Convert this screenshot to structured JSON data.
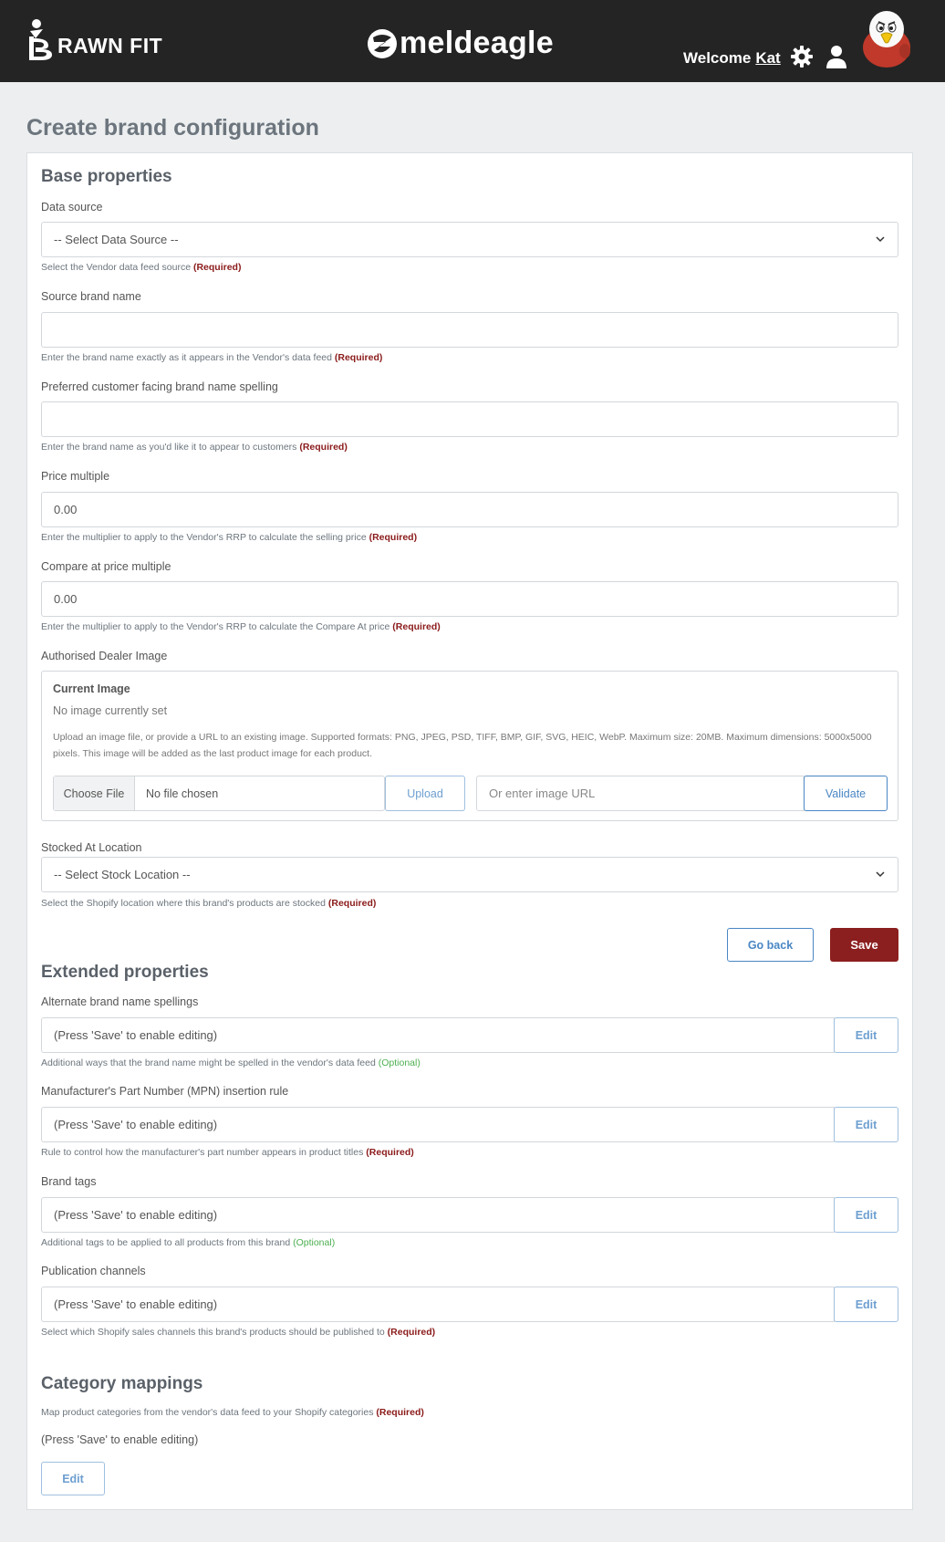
{
  "header": {
    "brand_logo_text": "RAWN FIT",
    "brand_logo_initial": "B",
    "app_logo_text": "meldeagle",
    "welcome_text": "Welcome",
    "username": "Kat"
  },
  "page": {
    "title": "Create brand configuration"
  },
  "base": {
    "title": "Base properties",
    "data_source": {
      "label": "Data source",
      "selected": "-- Select Data Source --",
      "help": "Select the Vendor data feed source",
      "tag": "(Required)"
    },
    "source_brand": {
      "label": "Source brand name",
      "value": "",
      "help": "Enter the brand name exactly as it appears in the Vendor's data feed",
      "tag": "(Required)"
    },
    "preferred_name": {
      "label": "Preferred customer facing brand name spelling",
      "value": "",
      "help": "Enter the brand name as you'd like it to appear to customers",
      "tag": "(Required)"
    },
    "price_multiple": {
      "label": "Price multiple",
      "value": "0.00",
      "help": "Enter the multiplier to apply to the Vendor's RRP to calculate the selling price",
      "tag": "(Required)"
    },
    "compare_multiple": {
      "label": "Compare at price multiple",
      "value": "0.00",
      "help": "Enter the multiplier to apply to the Vendor's RRP to calculate the Compare At price",
      "tag": "(Required)"
    },
    "dealer_image": {
      "label": "Authorised Dealer Image",
      "current_title": "Current Image",
      "current_value": "No image currently set",
      "upload_help_line1": "Upload an image file, or provide a URL to an existing image. Supported formats: PNG, JPEG, PSD, TIFF, BMP, GIF, SVG, HEIC, WebP. Maximum size: 20MB. Maximum dimensions: 5000x5000",
      "upload_help_line2": "pixels. This image will be added as the last product image for each product.",
      "choose_file": "Choose File",
      "no_file": "No file chosen",
      "upload_button": "Upload",
      "url_placeholder": "Or enter image URL",
      "validate_button": "Validate"
    },
    "stock_location": {
      "label": "Stocked At Location",
      "selected": "-- Select Stock Location --",
      "help": "Select the Shopify location where this brand's products are stocked",
      "tag": "(Required)"
    },
    "go_back": "Go back",
    "save": "Save"
  },
  "extended": {
    "title": "Extended properties",
    "alt_spellings": {
      "label": "Alternate brand name spellings",
      "value": "(Press 'Save' to enable editing)",
      "edit": "Edit",
      "help": "Additional ways that the brand name might be spelled in the vendor's data feed",
      "tag": "(Optional)"
    },
    "mpn_rule": {
      "label": "Manufacturer's Part Number (MPN) insertion rule",
      "value": "(Press 'Save' to enable editing)",
      "edit": "Edit",
      "help": "Rule to control how the manufacturer's part number appears in product titles",
      "tag": "(Required)"
    },
    "brand_tags": {
      "label": "Brand tags",
      "value": "(Press 'Save' to enable editing)",
      "edit": "Edit",
      "help": "Additional tags to be applied to all products from this brand",
      "tag": "(Optional)"
    },
    "pub_channels": {
      "label": "Publication channels",
      "value": "(Press 'Save' to enable editing)",
      "edit": "Edit",
      "help": "Select which Shopify sales channels this brand's products should be published to",
      "tag": "(Required)"
    }
  },
  "category": {
    "title": "Category mappings",
    "help": "Map product categories from the vendor's data feed to your Shopify categories",
    "tag": "(Required)",
    "note": "(Press 'Save' to enable editing)",
    "edit": "Edit"
  },
  "icons": {
    "brand_logo": "brawn-fit-logo-icon",
    "app_logo": "meldeagle-logo-icon",
    "settings": "gear-icon",
    "user": "user-icon",
    "mascot": "eagle-mascot-icon",
    "dropdown": "chevron-down-icon"
  }
}
